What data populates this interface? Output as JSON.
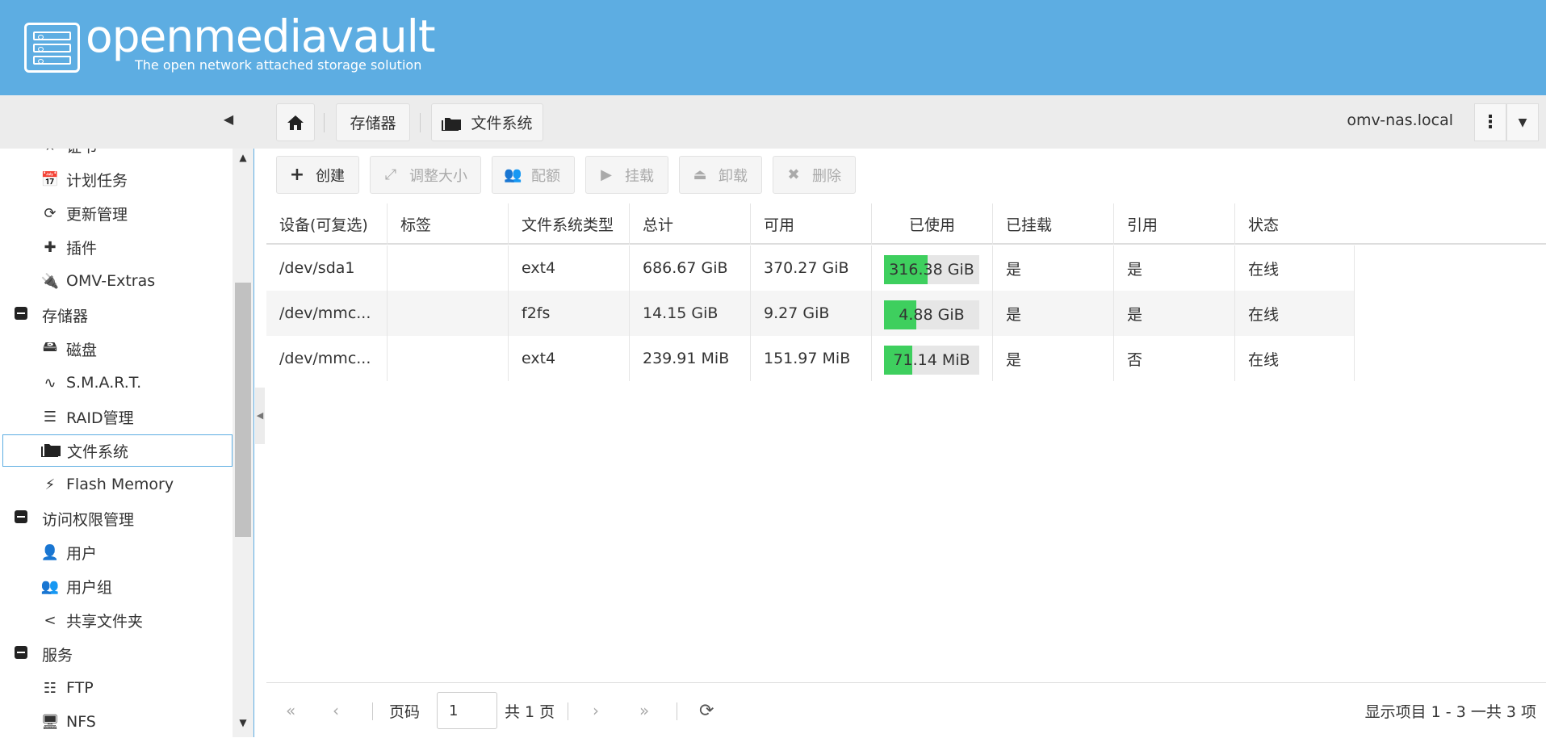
{
  "brand": {
    "name": "openmediavault",
    "tagline": "The open network attached storage solution"
  },
  "breadcrumb": {
    "items": [
      {
        "label": ""
      },
      {
        "label": "存储器"
      },
      {
        "label": "文件系统"
      }
    ]
  },
  "hostname": "omv-nas.local",
  "sidebar": {
    "items": [
      {
        "label": "证书",
        "icon": "star-icon"
      },
      {
        "label": "计划任务",
        "icon": "calendar-clock-icon"
      },
      {
        "label": "更新管理",
        "icon": "refresh-icon"
      },
      {
        "label": "插件",
        "icon": "puzzle-icon"
      },
      {
        "label": "OMV-Extras",
        "icon": "plug-icon"
      },
      {
        "label": "存储器",
        "icon": "minus-square-icon",
        "group": true
      },
      {
        "label": "磁盘",
        "icon": "harddisk-icon"
      },
      {
        "label": "S.M.A.R.T.",
        "icon": "pulse-icon"
      },
      {
        "label": "RAID管理",
        "icon": "database-icon"
      },
      {
        "label": "文件系统",
        "icon": "folder-icon",
        "active": true
      },
      {
        "label": "Flash Memory",
        "icon": "flash-icon"
      },
      {
        "label": "访问权限管理",
        "icon": "minus-square-icon",
        "group": true
      },
      {
        "label": "用户",
        "icon": "user-icon"
      },
      {
        "label": "用户组",
        "icon": "users-icon"
      },
      {
        "label": "共享文件夹",
        "icon": "share-icon"
      },
      {
        "label": "服务",
        "icon": "minus-square-icon",
        "group": true
      },
      {
        "label": "FTP",
        "icon": "server-icon"
      },
      {
        "label": "NFS",
        "icon": "monitor-icon"
      }
    ]
  },
  "actions": {
    "create": "创建",
    "resize": "调整大小",
    "quota": "配额",
    "mount": "挂载",
    "unmount": "卸载",
    "delete": "删除"
  },
  "table": {
    "columns": [
      "设备(可复选)",
      "标签",
      "文件系统类型",
      "总计",
      "可用",
      "已使用",
      "已挂载",
      "引用",
      "状态"
    ],
    "rows": [
      {
        "device": "/dev/sda1",
        "label": "",
        "fstype": "ext4",
        "total": "686.67 GiB",
        "available": "370.27 GiB",
        "used": "316.38 GiB",
        "used_fraction": 0.46,
        "mounted": "是",
        "referenced": "是",
        "status": "在线"
      },
      {
        "device": "/dev/mmc...",
        "label": "",
        "fstype": "f2fs",
        "total": "14.15 GiB",
        "available": "9.27 GiB",
        "used": "4.88 GiB",
        "used_fraction": 0.34,
        "mounted": "是",
        "referenced": "是",
        "status": "在线"
      },
      {
        "device": "/dev/mmc...",
        "label": "",
        "fstype": "ext4",
        "total": "239.91 MiB",
        "available": "151.97 MiB",
        "used": "71.14 MiB",
        "used_fraction": 0.3,
        "mounted": "是",
        "referenced": "否",
        "status": "在线"
      }
    ]
  },
  "pager": {
    "page_label": "页码",
    "page_value": "1",
    "total_pages": "共 1 页",
    "summary": "显示项目 1 - 3 一共 3 项"
  },
  "colors": {
    "header_bg": "#5dade2",
    "used_bar": "#3ecf5e"
  }
}
